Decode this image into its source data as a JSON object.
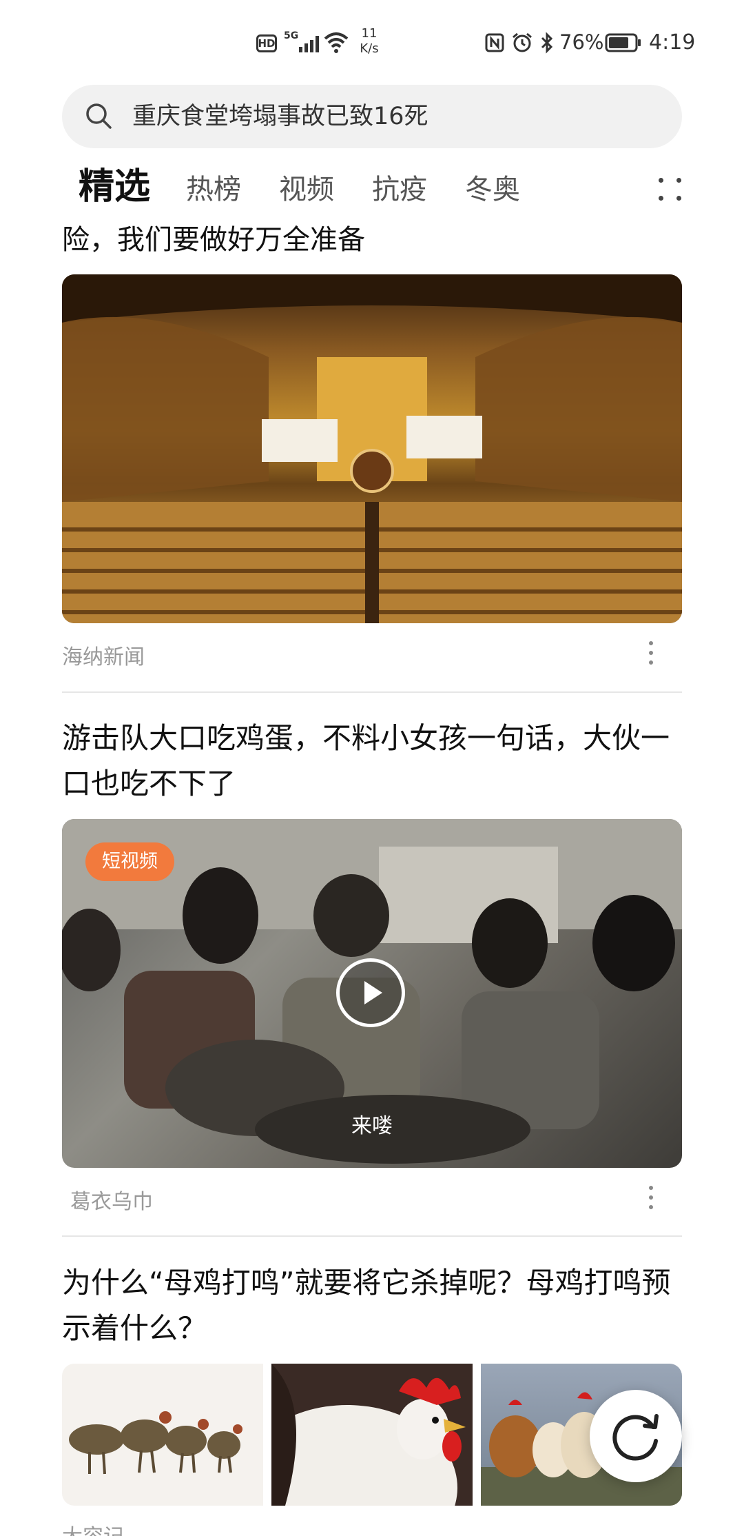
{
  "status_bar": {
    "hd": "HD",
    "network": "5G",
    "speed_value": "11",
    "speed_unit": "K/s",
    "battery": "76%",
    "time": "4:19"
  },
  "search": {
    "query": "重庆食堂垮塌事故已致16死"
  },
  "tabs": [
    {
      "label": "精选",
      "active": true
    },
    {
      "label": "热榜",
      "active": false
    },
    {
      "label": "视频",
      "active": false
    },
    {
      "label": "抗疫",
      "active": false
    },
    {
      "label": "冬奥",
      "active": false
    }
  ],
  "feed": {
    "item1": {
      "title_cut": "险，我们要做好万全准备",
      "source": "海纳新闻"
    },
    "item2": {
      "title": "游击队大口吃鸡蛋，不料小女孩一句话，大伙一口也吃不下了",
      "badge": "短视频",
      "subtitle": "来喽",
      "source": "葛衣乌巾"
    },
    "item3": {
      "title": "为什么“母鸡打鸣”就要将它杀掉呢？母鸡打鸣预示着什么？",
      "source": "大容记"
    }
  },
  "colors": {
    "badge": "#f27a3d",
    "search_bg": "#f1f1f1"
  }
}
